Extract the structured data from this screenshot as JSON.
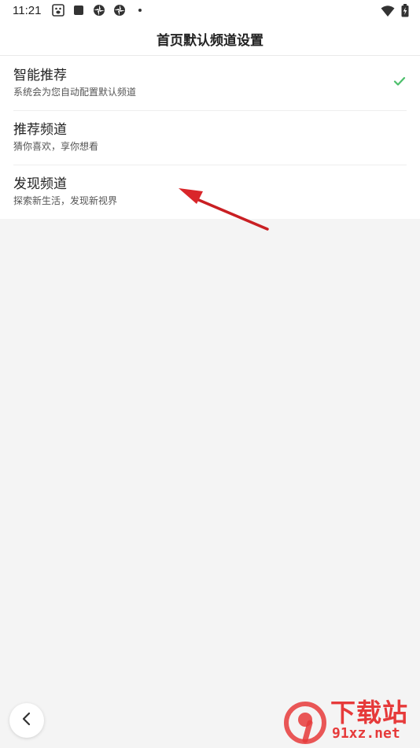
{
  "status_bar": {
    "time": "11:21"
  },
  "header": {
    "title": "首页默认频道设置"
  },
  "options": [
    {
      "title": "智能推荐",
      "desc": "系统会为您自动配置默认频道",
      "selected": true
    },
    {
      "title": "推荐频道",
      "desc": "猜你喜欢，享你想看",
      "selected": false
    },
    {
      "title": "发现频道",
      "desc": "探索新生活，发现新视界",
      "selected": false
    }
  ],
  "colors": {
    "check": "#4cbf6b",
    "arrow": "#d9262a",
    "watermark": "#e63a3a"
  },
  "watermark": {
    "top": "下载站",
    "bottom": "91xz.net",
    "logo_text": "9"
  }
}
